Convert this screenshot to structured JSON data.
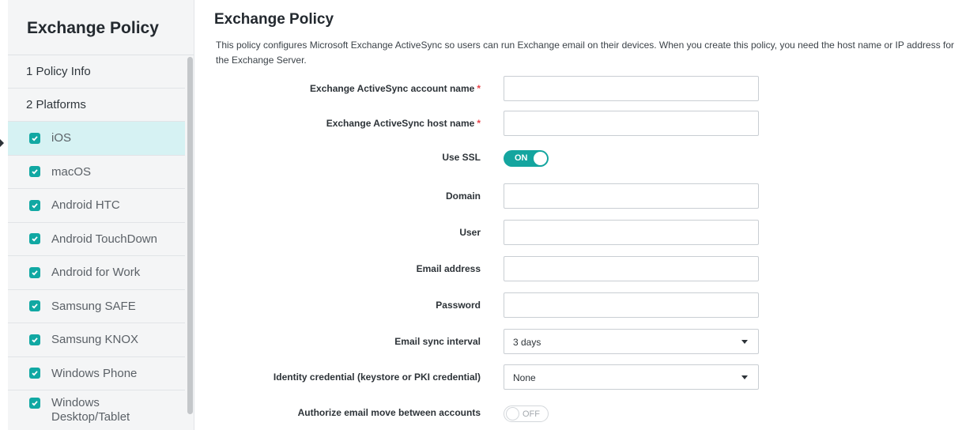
{
  "sidebar": {
    "title": "Exchange Policy",
    "sections": [
      {
        "label": "1  Policy Info"
      },
      {
        "label": "2  Platforms"
      }
    ],
    "platforms": [
      {
        "label": "iOS",
        "checked": true,
        "active": true
      },
      {
        "label": "macOS",
        "checked": true
      },
      {
        "label": "Android HTC",
        "checked": true
      },
      {
        "label": "Android TouchDown",
        "checked": true
      },
      {
        "label": "Android for Work",
        "checked": true
      },
      {
        "label": "Samsung SAFE",
        "checked": true
      },
      {
        "label": "Samsung KNOX",
        "checked": true
      },
      {
        "label": "Windows Phone",
        "checked": true
      },
      {
        "label": "Windows Desktop/Tablet",
        "checked": true
      }
    ]
  },
  "main": {
    "title": "Exchange Policy",
    "description": "This policy configures Microsoft Exchange ActiveSync so users can run Exchange email on their devices. When you create this policy, you need the host name or IP address for the Exchange Server.",
    "fields": {
      "account_name": {
        "label": "Exchange ActiveSync account name",
        "value": ""
      },
      "host_name": {
        "label": "Exchange ActiveSync host name",
        "value": ""
      },
      "use_ssl": {
        "label": "Use SSL",
        "state": "ON"
      },
      "domain": {
        "label": "Domain",
        "value": ""
      },
      "user": {
        "label": "User",
        "value": ""
      },
      "email": {
        "label": "Email address",
        "value": ""
      },
      "password": {
        "label": "Password",
        "value": ""
      },
      "sync_interval": {
        "label": "Email sync interval",
        "value": "3 days"
      },
      "identity": {
        "label": "Identity credential (keystore or PKI credential)",
        "value": "None"
      },
      "authorize_move": {
        "label": "Authorize email move between accounts",
        "state": "OFF"
      }
    },
    "required_marker": "*"
  },
  "colors": {
    "accent": "#14a59f",
    "active_bg": "#d6f2f3",
    "required": "#e8444a"
  },
  "icons": {
    "check": "checkbox-checked-icon",
    "caret": "caret-down-icon"
  }
}
